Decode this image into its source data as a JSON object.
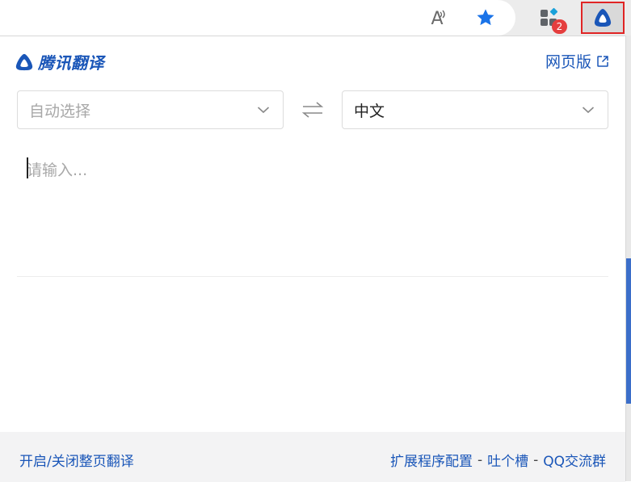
{
  "toolbar": {
    "read_aloud_glyph": "A",
    "extensions_badge": "2"
  },
  "popup": {
    "brand_name": "腾讯翻译",
    "web_version_label": "网页版",
    "source_lang": "自动选择",
    "target_lang": "中文",
    "input_value": "",
    "input_placeholder": "请输入..."
  },
  "footer": {
    "toggle_page_translate": "开启/关闭整页翻译",
    "extension_settings": "扩展程序配置",
    "feedback": "吐个槽",
    "qq_group": "QQ交流群",
    "separator": "-"
  },
  "colors": {
    "brand_blue": "#1a56b8",
    "active_border": "#e02424",
    "badge_red": "#e53e3e",
    "favorite_blue": "#1a73e8"
  },
  "icons": [
    "read-aloud-icon",
    "favorites-star-icon",
    "extensions-icon",
    "tencent-translate-logo-icon",
    "external-link-icon",
    "chevron-down-icon",
    "swap-arrows-icon"
  ]
}
